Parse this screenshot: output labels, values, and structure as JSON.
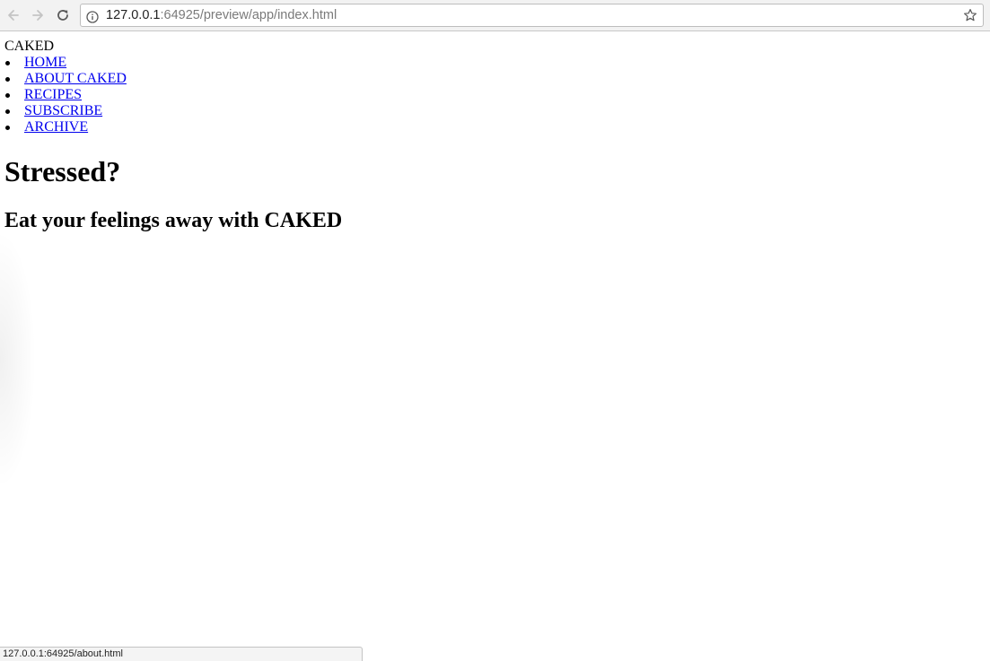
{
  "browser": {
    "url_host": "127.0.0.1",
    "url_rest": ":64925/preview/app/index.html",
    "status_url": "127.0.0.1:64925/about.html",
    "icons": {
      "back": "arrow-left-icon",
      "forward": "arrow-right-icon",
      "reload": "reload-icon",
      "site_info": "info-icon",
      "bookmark": "star-icon"
    }
  },
  "site": {
    "brand": "CAKED",
    "nav": [
      {
        "label": "HOME"
      },
      {
        "label": "ABOUT CAKED"
      },
      {
        "label": "RECIPES"
      },
      {
        "label": "SUBSCRIBE"
      },
      {
        "label": "ARCHIVE"
      }
    ],
    "hero_title": "Stressed?",
    "hero_subtitle": "Eat your feelings away with CAKED"
  },
  "colors": {
    "link": "#0000ee",
    "text": "#000000",
    "toolbar_bg": "#f2f2f2"
  }
}
